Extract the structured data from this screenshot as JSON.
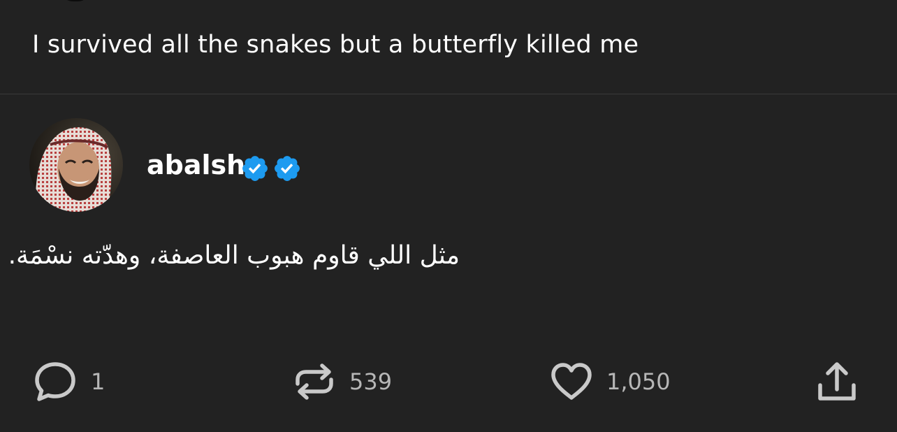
{
  "post": {
    "text": "I survived all the snakes but a butterfly killed me"
  },
  "quoted": {
    "username": "abalsh",
    "badges": [
      "verified-badge-icon",
      "verified-badge-icon"
    ],
    "text": "مثل اللي قاوم هبوب العاصفة، وهدّته نسْمَة."
  },
  "actions": {
    "comments": "1",
    "reposts": "539",
    "likes": "1,050"
  },
  "colors": {
    "background": "#222222",
    "text": "#ffffff",
    "count": "#b7b7b7",
    "icon": "#c9c9c9",
    "badge": "#1d9bf0",
    "divider": "#3b3b3b"
  }
}
